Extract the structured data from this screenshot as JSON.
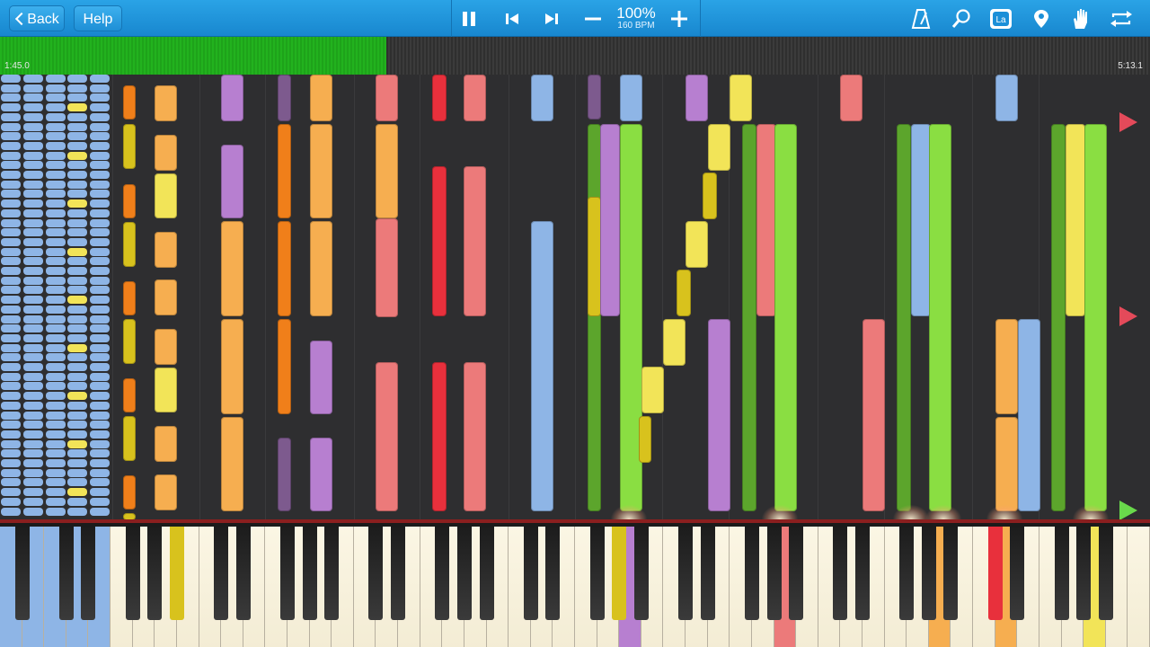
{
  "toolbar": {
    "back_label": "Back",
    "help_label": "Help",
    "zoom": "100%",
    "bpm": "160 BPM",
    "icons": [
      "pause-icon",
      "skip-back-icon",
      "skip-forward-icon",
      "minus-icon",
      "plus-icon",
      "metronome-icon",
      "search-icon",
      "label-icon",
      "location-icon",
      "hand-icon",
      "loop-icon"
    ],
    "label_icon_text": "La"
  },
  "playback": {
    "current_time": "1:45.0",
    "total_time": "5:13.1",
    "progress_fraction": 0.336
  },
  "colors": {
    "accent": "#1b8fd8",
    "progress": "#22b21e",
    "note_blue": "#8eb5e6",
    "note_orange": "#f6ae50",
    "note_dark_orange": "#f07f1a",
    "note_yellow": "#f2e458",
    "note_dark_yellow": "#d8c21d",
    "note_purple": "#b77fd0",
    "note_dark_purple": "#7d5a8e",
    "note_pink": "#ec7a7a",
    "note_red": "#e8303c",
    "note_light_green": "#8ade42",
    "note_green": "#5ca52c",
    "marker_red": "#e44a5a",
    "marker_green": "#69d94b"
  }
}
